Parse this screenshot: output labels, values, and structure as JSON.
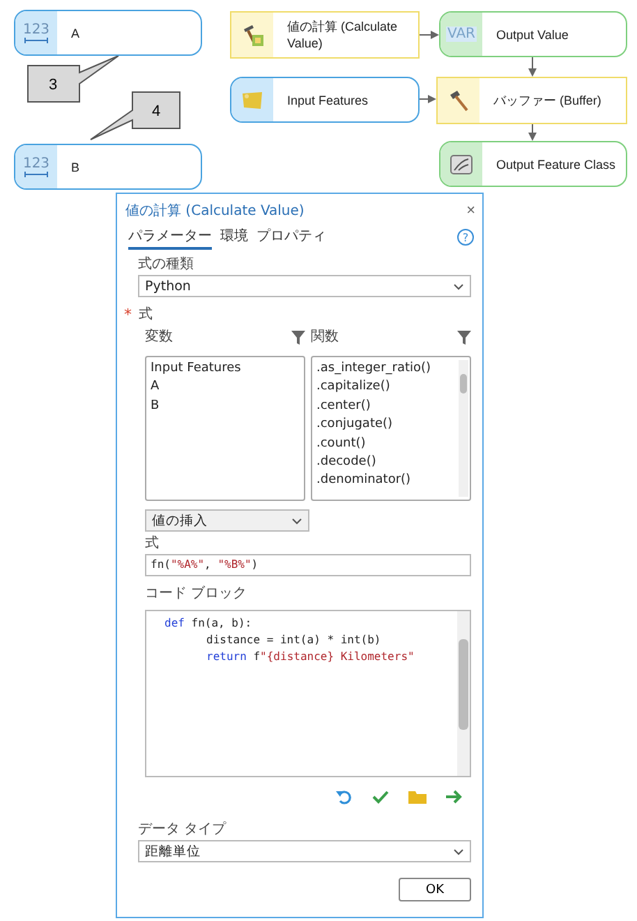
{
  "canvas": {
    "nodes": [
      {
        "kind": "variable",
        "label": "A",
        "icon_text": "123"
      },
      {
        "kind": "variable",
        "label": "B",
        "icon_text": "123"
      },
      {
        "kind": "calc-tool",
        "label": "値の計算 (Calculate Value)"
      },
      {
        "kind": "output-value",
        "label": "Output Value",
        "icon_text": "VAR"
      },
      {
        "kind": "data",
        "label": "Input Features"
      },
      {
        "kind": "tool",
        "label": "バッファー (Buffer)"
      },
      {
        "kind": "output-data",
        "label": "Output Feature Class"
      }
    ],
    "callouts": [
      {
        "label": "3"
      },
      {
        "label": "4"
      }
    ]
  },
  "dialog": {
    "title": "値の計算 (Calculate Value)",
    "close": "×",
    "help": "?",
    "tabs": [
      {
        "label": "パラメーター",
        "selected": true
      },
      {
        "label": "環境",
        "selected": false
      },
      {
        "label": "プロパティ",
        "selected": false
      }
    ],
    "expression_type": {
      "label": "式の種類",
      "value": "Python"
    },
    "expression_section": {
      "label": "式",
      "required": true,
      "required_mark": "*"
    },
    "variables": {
      "label": "変数",
      "items": [
        "Input Features",
        "A",
        "B"
      ]
    },
    "functions": {
      "label": "関数",
      "items": [
        ".as_integer_ratio()",
        ".capitalize()",
        ".center()",
        ".conjugate()",
        ".count()",
        ".decode()",
        ".denominator()"
      ]
    },
    "insert_value": {
      "value": "値の挿入"
    },
    "expression": {
      "label": "式",
      "tokens": [
        {
          "text": "fn(",
          "kind": "plain"
        },
        {
          "text": "\"%A%\"",
          "kind": "string"
        },
        {
          "text": ", ",
          "kind": "plain"
        },
        {
          "text": "\"%B%\"",
          "kind": "string"
        },
        {
          "text": ")",
          "kind": "plain"
        }
      ]
    },
    "code_block": {
      "label": "コード ブロック",
      "lines": [
        {
          "kind": "header",
          "tokens": [
            {
              "text": "def",
              "kind": "keyword"
            },
            {
              "text": " fn(a, b):",
              "kind": "plain"
            }
          ]
        },
        {
          "kind": "body",
          "tokens": [
            {
              "text": "distance = int(a) * int(b)",
              "kind": "plain"
            }
          ]
        },
        {
          "kind": "body",
          "tokens": [
            {
              "text": "return",
              "kind": "keyword"
            },
            {
              "text": " f",
              "kind": "plain"
            },
            {
              "text": "\"{distance} Kilometers\"",
              "kind": "string"
            }
          ]
        }
      ]
    },
    "data_type": {
      "label": "データ タイプ",
      "value": "距離単位"
    },
    "ok_button": "OK"
  }
}
